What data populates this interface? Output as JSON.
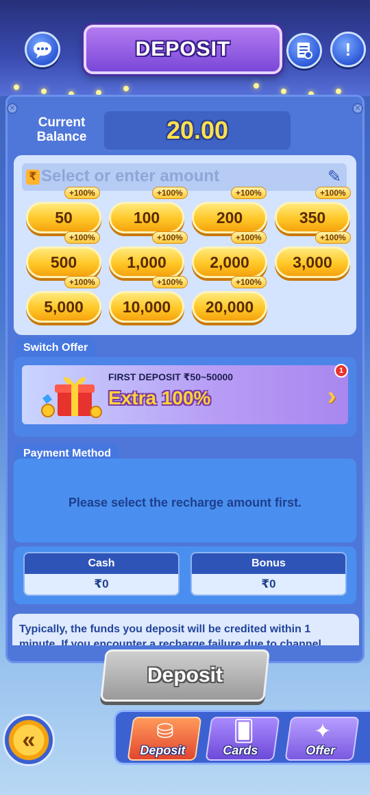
{
  "header": {
    "title": "DEPOSIT",
    "support_icon": "chat-support-icon",
    "records_icon": "records-icon",
    "info_icon": "exclamation-icon"
  },
  "balance": {
    "label": "Current Balance",
    "value": "20.00"
  },
  "amount": {
    "placeholder": "Select or enter amount",
    "options": [
      {
        "amount": "50",
        "bonus": "+100%"
      },
      {
        "amount": "100",
        "bonus": "+100%"
      },
      {
        "amount": "200",
        "bonus": "+100%"
      },
      {
        "amount": "350",
        "bonus": "+100%"
      },
      {
        "amount": "500",
        "bonus": "+100%"
      },
      {
        "amount": "1,000",
        "bonus": "+100%"
      },
      {
        "amount": "2,000",
        "bonus": "+100%"
      },
      {
        "amount": "3,000",
        "bonus": "+100%"
      },
      {
        "amount": "5,000",
        "bonus": "+100%"
      },
      {
        "amount": "10,000",
        "bonus": "+100%"
      },
      {
        "amount": "20,000",
        "bonus": "+100%"
      }
    ]
  },
  "offer": {
    "tab_label": "Switch Offer",
    "subtitle": "FIRST DEPOSIT ₹50~50000",
    "headline": "Extra 100%",
    "badge_count": "1"
  },
  "payment": {
    "tab_label": "Payment Method",
    "message": "Please select the recharge amount first."
  },
  "wallet": {
    "cash_label": "Cash",
    "cash_value": "₹0",
    "bonus_label": "Bonus",
    "bonus_value": "₹0"
  },
  "note": {
    "text": "Typically, the funds you deposit will be credited within 1 minute. If you encounter a recharge failure due to channel fluctuations, we"
  },
  "deposit_button": {
    "label": "Deposit"
  },
  "bottom_nav": {
    "items": [
      {
        "label": "Deposit",
        "icon": "chips-icon"
      },
      {
        "label": "Cards",
        "icon": "cards-icon"
      },
      {
        "label": "Offer",
        "icon": "party-popper-icon"
      }
    ]
  },
  "colors": {
    "accent_gold": "#ffc727",
    "panel_blue": "#4f77d9",
    "title_purple": "#7a48d8"
  }
}
